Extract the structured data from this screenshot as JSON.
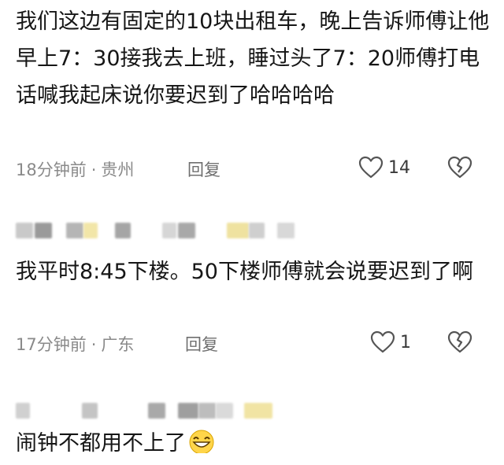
{
  "comments": [
    {
      "text": "我们这边有固定的10块出租车，晚上告诉师傅让他早上7：30接我去上班，睡过头了7：20师傅打电话喊我起床说你要迟到了哈哈哈哈",
      "time": "18分钟前",
      "separator": "·",
      "location": "贵州",
      "reply_label": "回复",
      "likes": "14"
    },
    {
      "text": "我平时8:45下楼。50下楼师傅就会说要迟到了啊",
      "time": "17分钟前",
      "separator": "·",
      "location": "广东",
      "reply_label": "回复",
      "likes": "1"
    },
    {
      "text": "闹钟不都用不上了",
      "emoji": "grinning-emoji"
    }
  ],
  "icons": {
    "like": "heart-icon",
    "dislike": "broken-heart-icon"
  },
  "colors": {
    "text": "#161616",
    "meta": "#8a8a8a",
    "icon": "#555555"
  }
}
